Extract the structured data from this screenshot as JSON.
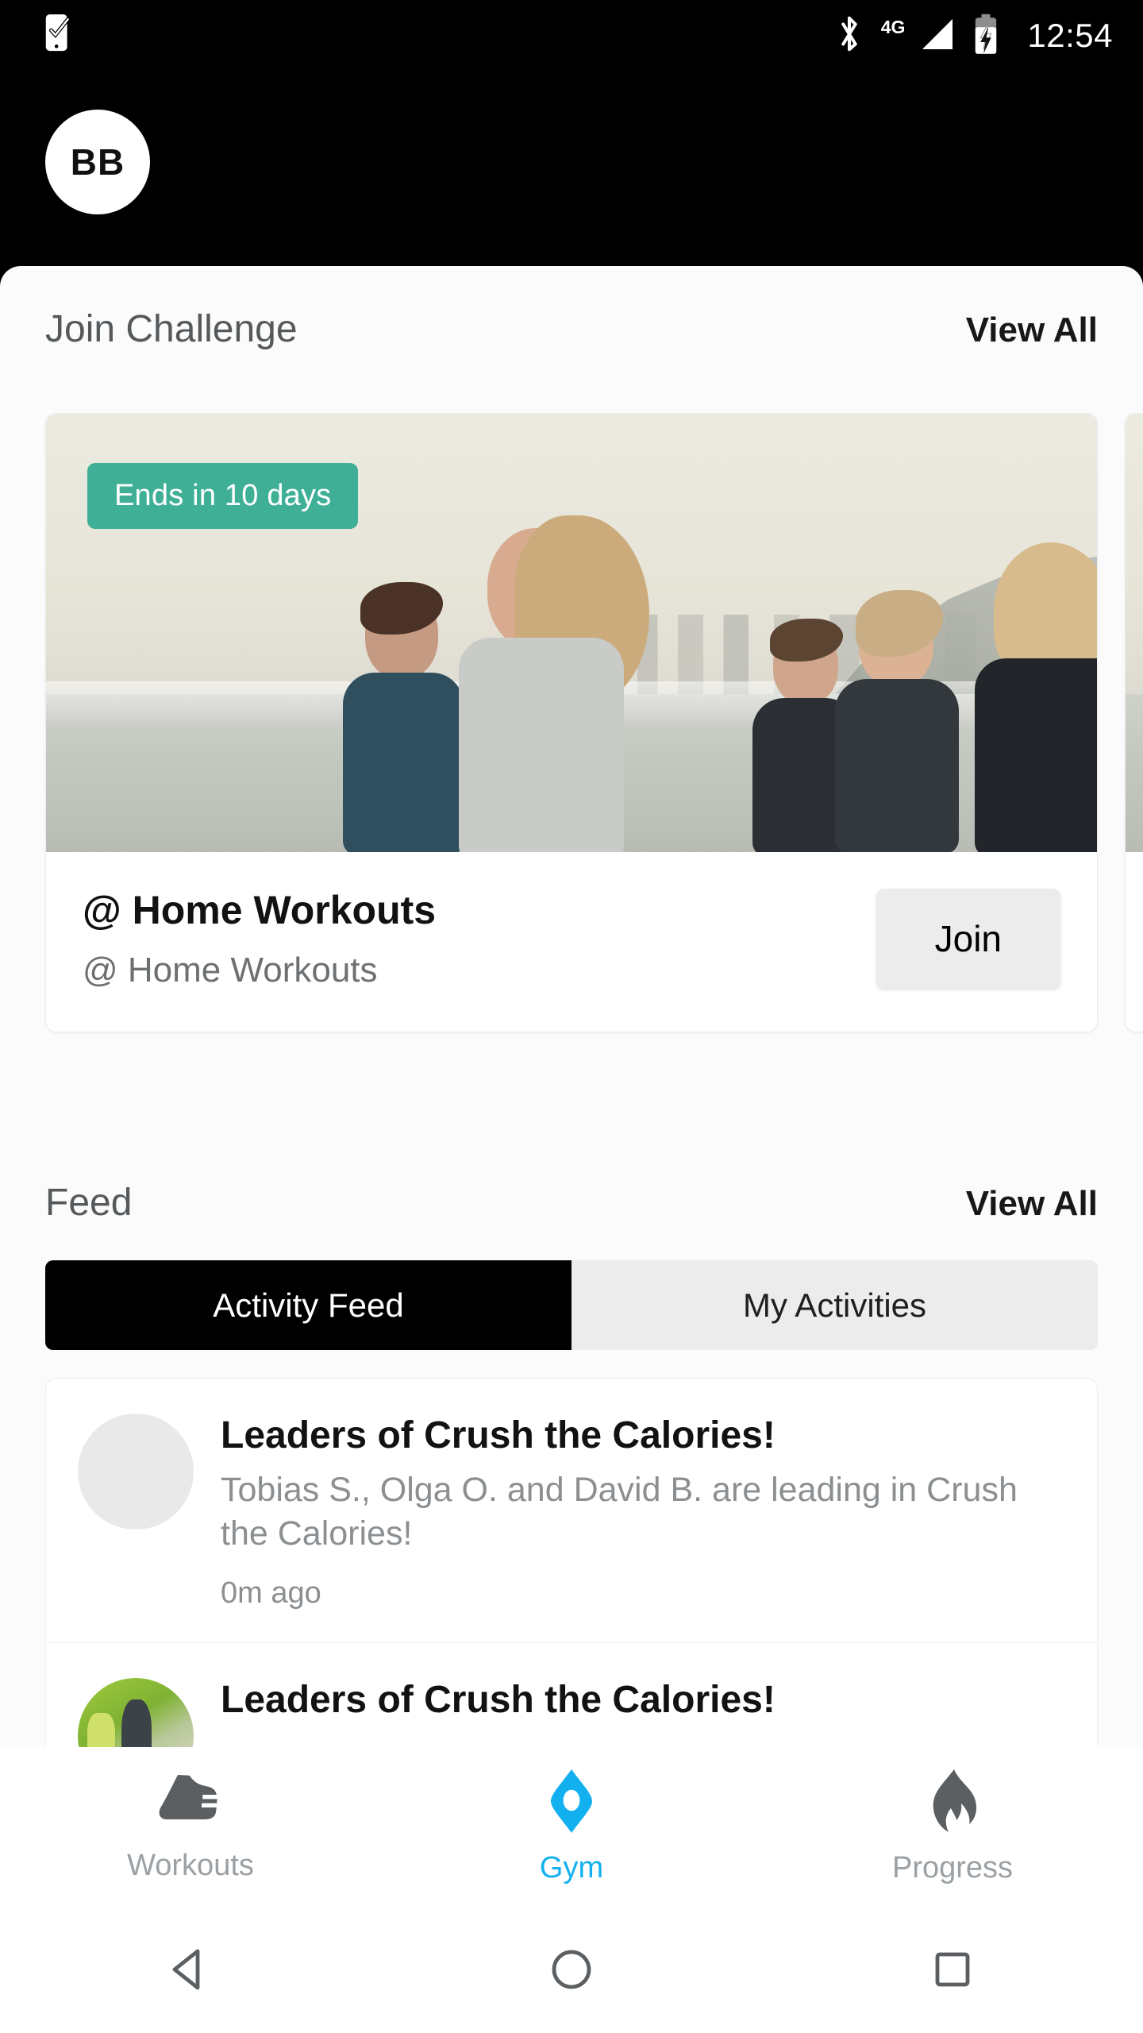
{
  "status_bar": {
    "notification_icon": "phone-check-icon",
    "bluetooth_icon": "bluetooth-icon",
    "network_type": "4G",
    "signal_icon": "signal-bars-icon",
    "battery_icon": "battery-charging-icon",
    "clock": "12:54"
  },
  "header": {
    "avatar_initials": "BB"
  },
  "challenge_section": {
    "title": "Join Challenge",
    "view_all": "View All",
    "cards": [
      {
        "badge": "Ends in 10 days",
        "title": "@ Home Workouts",
        "subtitle": "@ Home Workouts",
        "action": "Join",
        "image": "runners-on-beach-photo"
      },
      {
        "badge": "",
        "title": "",
        "subtitle": "",
        "action": "",
        "image": "beach-photo"
      }
    ]
  },
  "feed_section": {
    "title": "Feed",
    "view_all": "View All",
    "tabs": [
      {
        "label": "Activity Feed",
        "active": true
      },
      {
        "label": "My Activities",
        "active": false
      }
    ],
    "items": [
      {
        "title": "Leaders of Crush the Calories!",
        "description": "Tobias S., Olga O. and David B. are leading in Crush the Calories!",
        "time": "0m ago",
        "avatar": "placeholder-avatar"
      },
      {
        "title": "Leaders of Crush the Calories!",
        "description": "",
        "time": "",
        "avatar": "outdoor-photo-avatar"
      }
    ]
  },
  "bottom_nav": {
    "items": [
      {
        "label": "Workouts",
        "icon": "shoe-icon",
        "active": false
      },
      {
        "label": "Gym",
        "icon": "gym-pin-icon",
        "active": true
      },
      {
        "label": "Progress",
        "icon": "flame-icon",
        "active": false
      }
    ],
    "active_color": "#12b0ef",
    "inactive_color": "#9aa0a4"
  },
  "android_nav": {
    "back": "back-triangle-icon",
    "home": "home-circle-icon",
    "recents": "recents-square-icon"
  },
  "colors": {
    "accent": "#12b0ef",
    "badge_green": "#3faf96",
    "header_black": "#000000",
    "sheet_bg": "#fbfbfb"
  }
}
